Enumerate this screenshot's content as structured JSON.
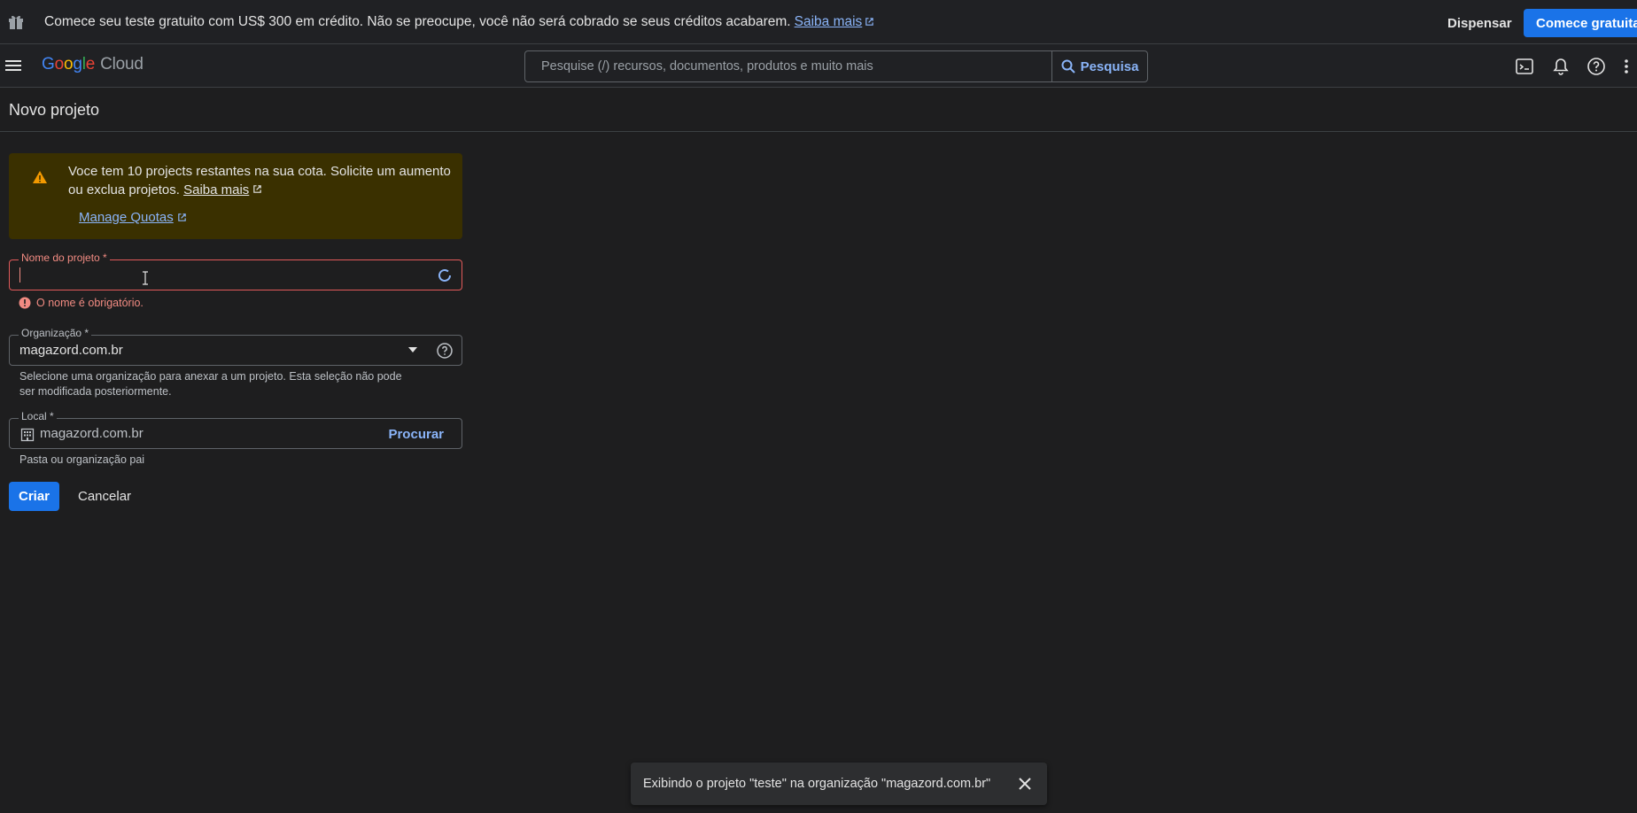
{
  "promo": {
    "message": "Comece seu teste gratuito com US$ 300 em crédito. Não se preocupe, você não será cobrado se seus créditos acabarem.",
    "link_label": "Saiba mais",
    "dismiss_label": "Dispensar",
    "cta_label": "Comece gratuitamente"
  },
  "topbar": {
    "logo_google": [
      "G",
      "o",
      "o",
      "g",
      "l",
      "e"
    ],
    "logo_product": "Cloud",
    "search_placeholder": "Pesquise (/) recursos, documentos, produtos e muito mais",
    "search_button": "Pesquisa"
  },
  "page": {
    "title": "Novo projeto"
  },
  "warning": {
    "text": "Voce tem 10 projects restantes na sua cota. Solicite um aumento ou exclua projetos.",
    "inline_link": "Saiba mais",
    "quota_link": "Manage Quotas"
  },
  "form": {
    "project_name": {
      "label": "Nome do projeto *",
      "value": "",
      "error": "O nome é obrigatório."
    },
    "organization": {
      "label": "Organização *",
      "value": "magazord.com.br",
      "hint": "Selecione uma organização para anexar a um projeto. Esta seleção não pode ser modificada posteriormente."
    },
    "location": {
      "label": "Local *",
      "value": "magazord.com.br",
      "browse_label": "Procurar",
      "hint": "Pasta ou organização pai"
    },
    "create_label": "Criar",
    "cancel_label": "Cancelar"
  },
  "snackbar": {
    "text": "Exibindo o projeto \"teste\" na organização \"magazord.com.br\""
  },
  "colors": {
    "accent": "#1a73e8",
    "link": "#8ab4f8",
    "error": "#f28b82",
    "warning_bg": "#3a3000",
    "warning_icon": "#f29900"
  }
}
